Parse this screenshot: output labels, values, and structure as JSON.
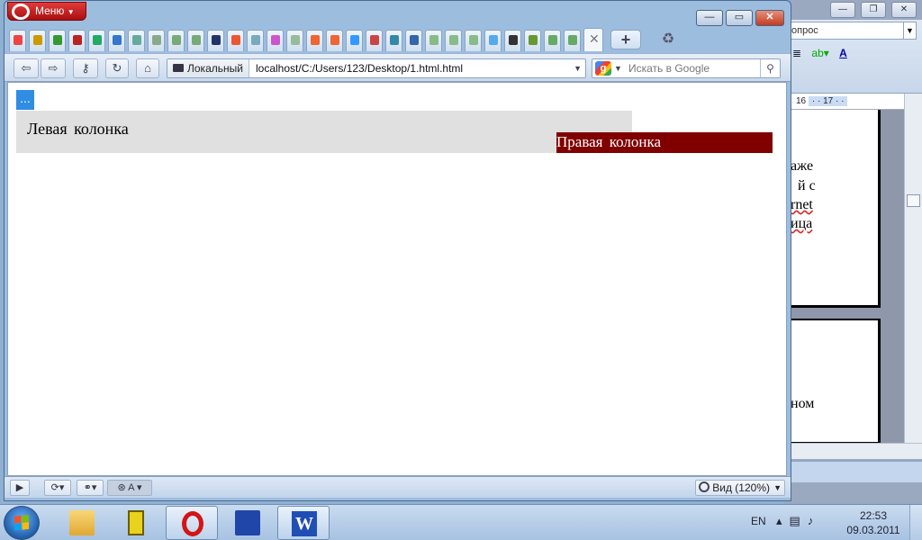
{
  "opera": {
    "menu_label": "Меню",
    "address_badge": "Локальный",
    "url": "localhost/C:/Users/123/Desktop/1.html.html",
    "search_placeholder": "Искать в Google",
    "zoom_label": "Вид (120%)",
    "content": {
      "dots": "...",
      "left_column": "Левая колонка",
      "right_column": "Правая колонка"
    },
    "colors": {
      "left_column_bg": "#e0e0e0",
      "right_column_bg": "#800000",
      "dots_bg": "#2f8de4"
    }
  },
  "word": {
    "ask_box": "опрос",
    "ruler_16": "16",
    "ruler_17": "17",
    "text_fragments": [
      "аже",
      "й с",
      "rnet",
      "ица",
      "ном"
    ]
  },
  "taskbar": {
    "language": "EN",
    "time": "22:53",
    "date": "09.03.2011"
  }
}
